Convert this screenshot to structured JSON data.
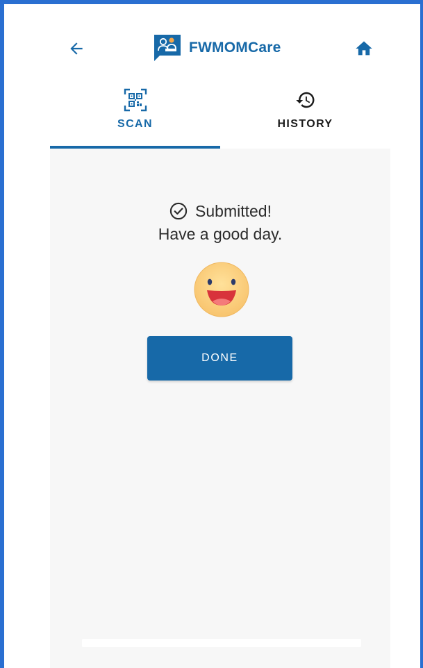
{
  "header": {
    "app_name": "FWMOMCare",
    "back_icon": "arrow-left-icon",
    "home_icon": "home-icon",
    "logo_icon": "fwmomcare-logo-icon"
  },
  "tabs": [
    {
      "label": "SCAN",
      "icon": "qr-code-icon",
      "active": true
    },
    {
      "label": "HISTORY",
      "icon": "history-icon",
      "active": false
    }
  ],
  "message": {
    "icon": "check-circle-icon",
    "line1": "Submitted!",
    "line2": "Have a good day."
  },
  "emoji": "smiling-face-icon",
  "done_button": {
    "label": "DONE"
  },
  "colors": {
    "primary": "#1769a8",
    "frame": "#2a6fd1",
    "content_bg": "#f7f7f7",
    "text_dark": "#2b2b2b",
    "emoji_face": "#fbcd78"
  }
}
